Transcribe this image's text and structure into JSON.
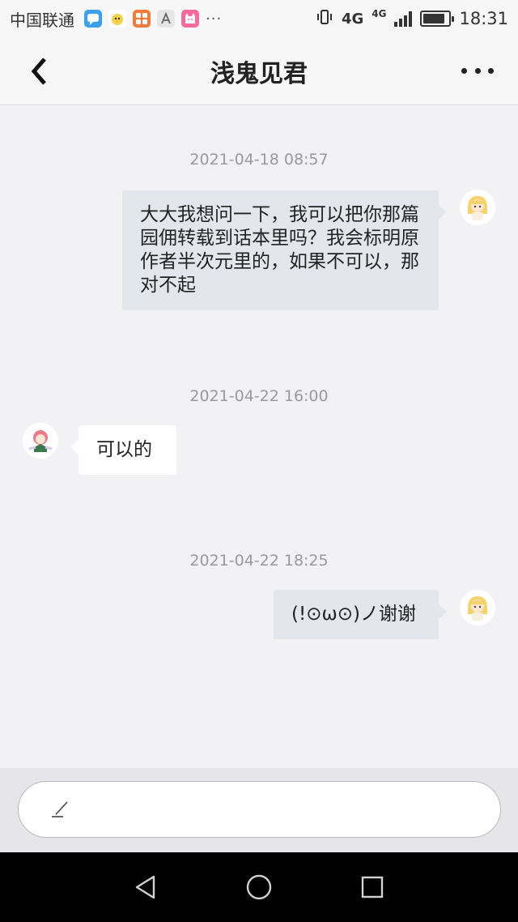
{
  "status_bar": {
    "carrier": "中国联通",
    "dots": "···",
    "network": "4G",
    "network_small": "4G",
    "time": "18:31",
    "battery_level": 0.85
  },
  "header": {
    "title": "浅鬼见君"
  },
  "messages": [
    {
      "timestamp": "2021-04-18 08:57",
      "direction": "out",
      "text": "大大我想问一下，我可以把你那篇园佣转载到话本里吗？我会标明原作者半次元里的，如果不可以，那对不起"
    },
    {
      "timestamp": "2021-04-22 16:00",
      "direction": "in",
      "text": "可以的"
    },
    {
      "timestamp": "2021-04-22 18:25",
      "direction": "out",
      "text": "(!⊙ω⊙)ノ谢谢"
    }
  ],
  "input": {
    "placeholder": ""
  },
  "colors": {
    "background": "#f2f2f5",
    "outgoing_bubble": "#e3e7eb",
    "incoming_bubble": "#ffffff",
    "timestamp": "#9a9a9a",
    "nav_bar": "#000000"
  },
  "icons": {
    "back": "chevron-left-icon",
    "more": "more-dots-icon",
    "pen": "pen-icon",
    "nav_back": "triangle-back-icon",
    "nav_home": "circle-home-icon",
    "nav_recent": "square-recent-icon"
  }
}
